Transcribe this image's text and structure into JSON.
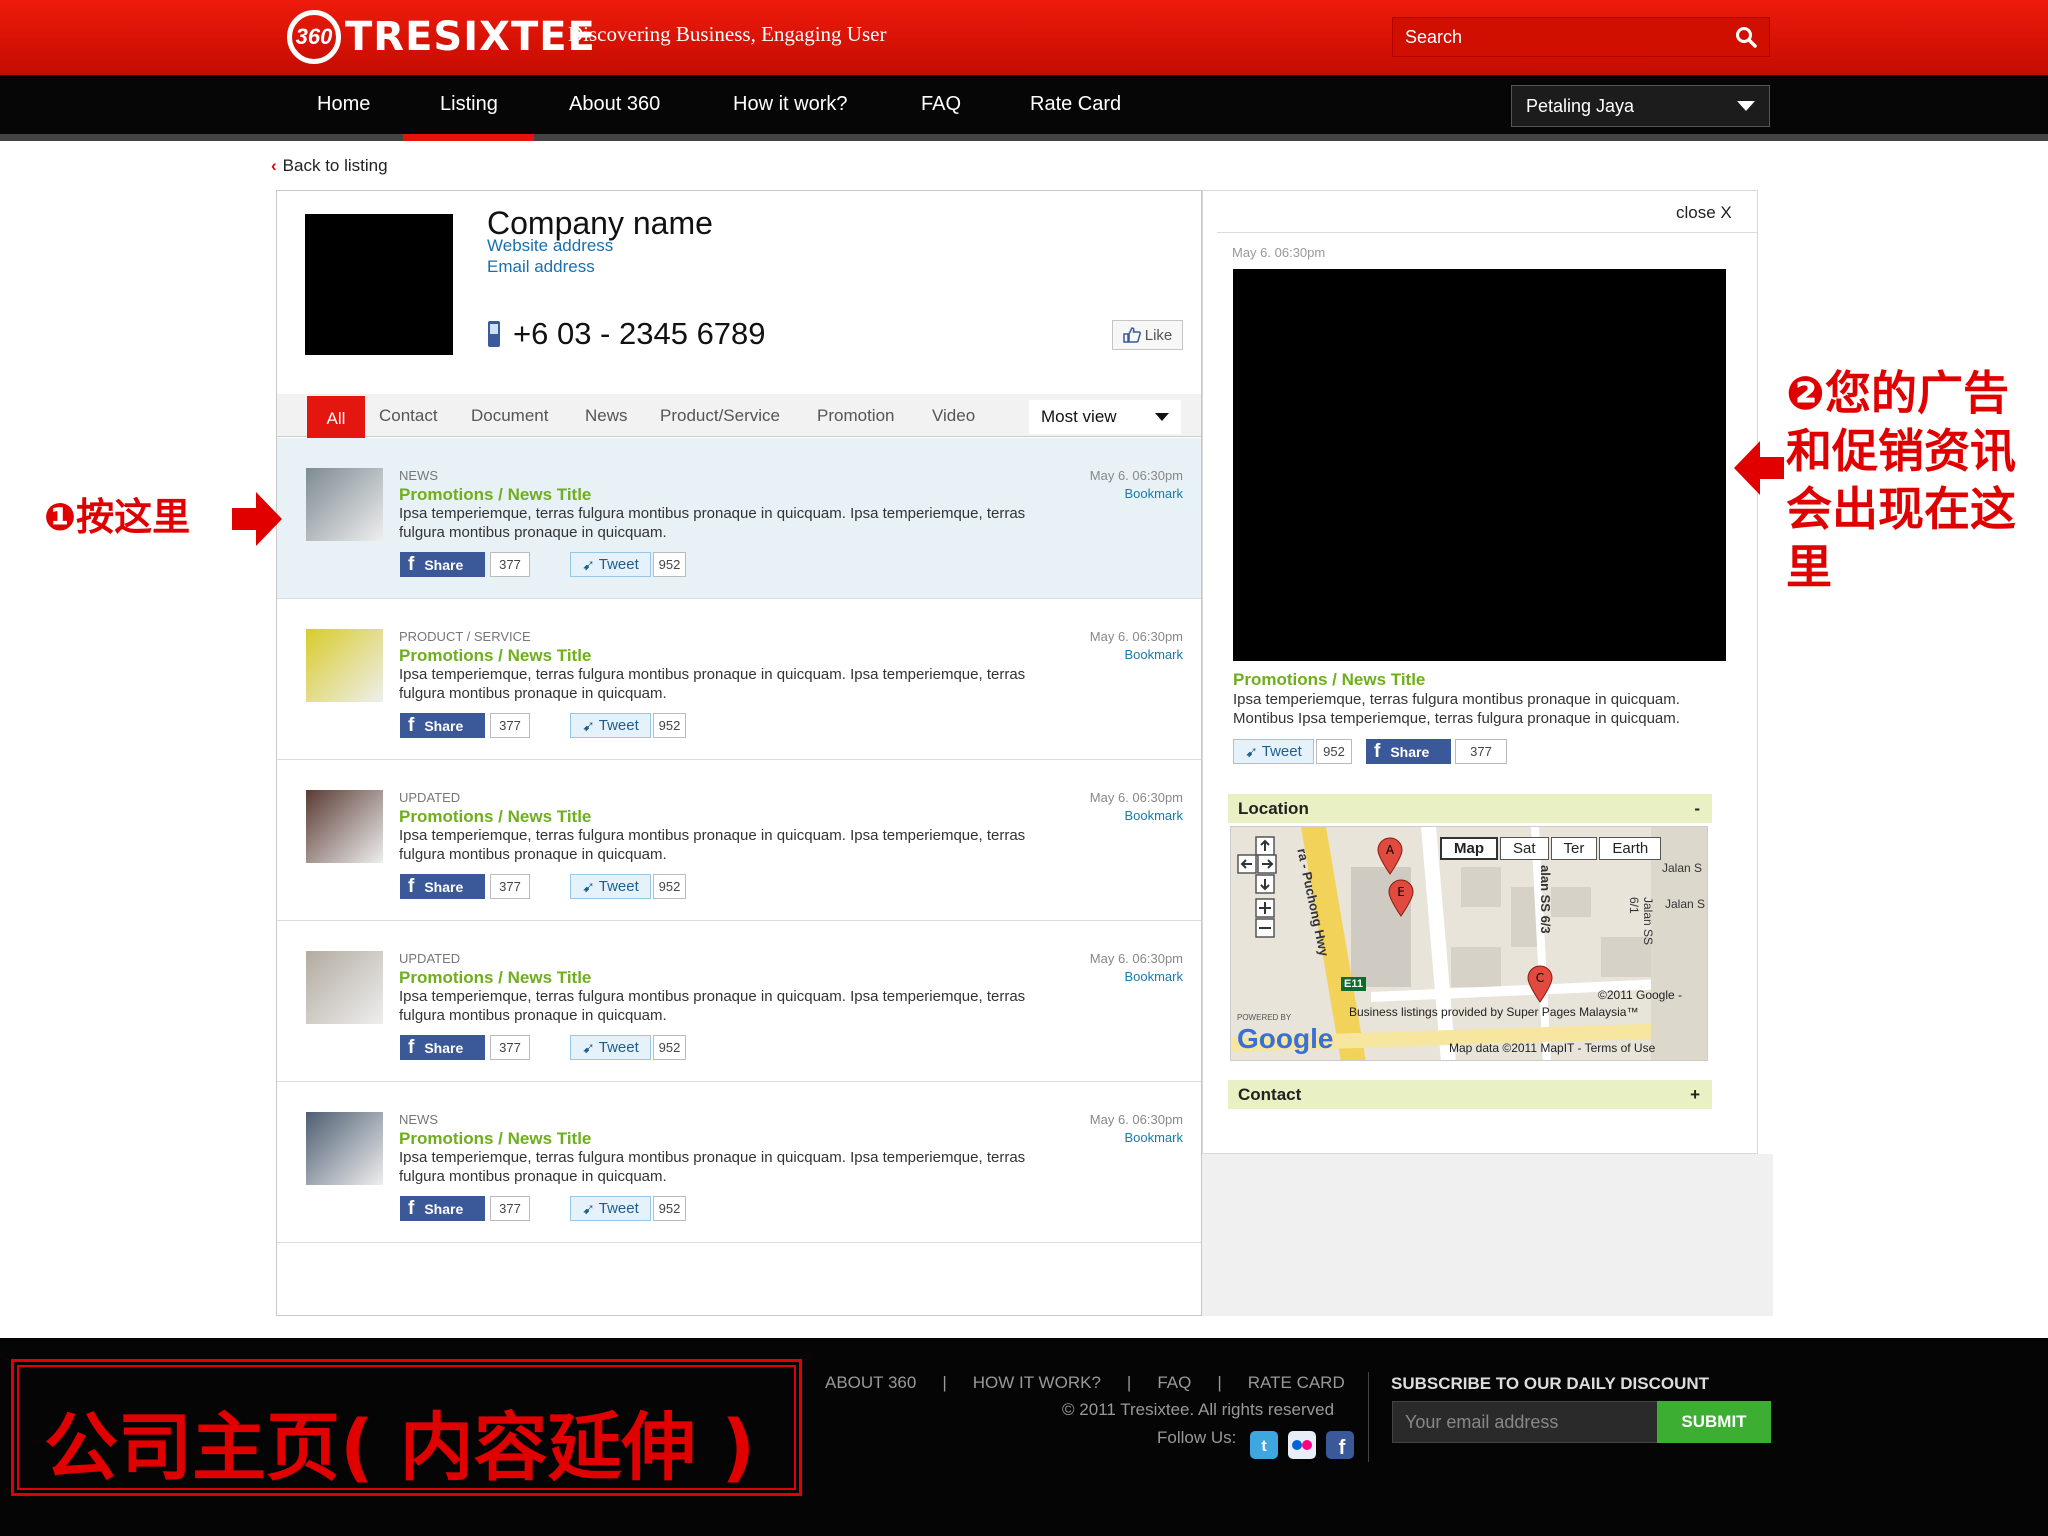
{
  "header": {
    "logo_mark": "360",
    "logo_text": "TRESIXTEE",
    "tagline": "Discovering Business, Engaging User",
    "search_placeholder": "Search"
  },
  "nav": {
    "items": [
      "Home",
      "Listing",
      "About 360",
      "How it work?",
      "FAQ",
      "Rate Card"
    ],
    "active": "Listing",
    "region": "Petaling Jaya"
  },
  "back_link": "Back to listing",
  "company": {
    "name": "Company name",
    "website": "Website address",
    "email": "Email address",
    "phone": "+6 03 - 2345 6789",
    "like_label": "Like"
  },
  "tabs": {
    "all": "All",
    "items": [
      "Contact",
      "Document",
      "News",
      "Product/Service",
      "Promotion",
      "Video"
    ],
    "sort": "Most view"
  },
  "listings": [
    {
      "category": "NEWS",
      "title": "Promotions / News Title",
      "desc": "Ipsa temperiemque, terras fulgura montibus pronaque in quicquam. Ipsa temperiemque, terras fulgura montibus pronaque in quicquam.",
      "date": "May 6. 06:30pm",
      "bookmark": "Bookmark",
      "share": "Share",
      "share_count": "377",
      "tweet": "Tweet",
      "tweet_count": "952",
      "thumb_color": "#7d8a92"
    },
    {
      "category": "PRODUCT / SERVICE",
      "title": "Promotions / News Title",
      "desc": "Ipsa temperiemque, terras fulgura montibus pronaque in quicquam. Ipsa temperiemque, terras fulgura montibus pronaque in quicquam.",
      "date": "May 6. 06:30pm",
      "bookmark": "Bookmark",
      "share": "Share",
      "share_count": "377",
      "tweet": "Tweet",
      "tweet_count": "952",
      "thumb_color": "#d8cc2a"
    },
    {
      "category": "UPDATED",
      "title": "Promotions / News Title",
      "desc": "Ipsa temperiemque, terras fulgura montibus pronaque in quicquam. Ipsa temperiemque, terras fulgura montibus pronaque in quicquam.",
      "date": "May 6. 06:30pm",
      "bookmark": "Bookmark",
      "share": "Share",
      "share_count": "377",
      "tweet": "Tweet",
      "tweet_count": "952",
      "thumb_color": "#5a3b33"
    },
    {
      "category": "UPDATED",
      "title": "Promotions / News Title",
      "desc": "Ipsa temperiemque, terras fulgura montibus pronaque in quicquam. Ipsa temperiemque, terras fulgura montibus pronaque in quicquam.",
      "date": "May 6. 06:30pm",
      "bookmark": "Bookmark",
      "share": "Share",
      "share_count": "377",
      "tweet": "Tweet",
      "tweet_count": "952",
      "thumb_color": "#b2aba0"
    },
    {
      "category": "NEWS",
      "title": "Promotions / News Title",
      "desc": "Ipsa temperiemque, terras fulgura montibus pronaque in quicquam. Ipsa temperiemque, terras fulgura montibus pronaque in quicquam.",
      "date": "May 6. 06:30pm",
      "bookmark": "Bookmark",
      "share": "Share",
      "share_count": "377",
      "tweet": "Tweet",
      "tweet_count": "952",
      "thumb_color": "#4e5e72"
    }
  ],
  "detail": {
    "close": "close X",
    "date": "May 6. 06:30pm",
    "title": "Promotions / News Title",
    "desc": "Ipsa temperiemque, terras fulgura montibus pronaque in quicquam. Montibus Ipsa temperiemque, terras fulgura pronaque in quicquam.",
    "tweet": "Tweet",
    "tweet_count": "952",
    "share": "Share",
    "share_count": "377",
    "location_label": "Location",
    "location_toggle": "-",
    "contact_label": "Contact",
    "contact_toggle": "+"
  },
  "map": {
    "types": [
      "Map",
      "Sat",
      "Ter",
      "Earth"
    ],
    "road_label": "ra - Puchong Hwy",
    "road_ss63": "alan SS 6/3",
    "road_ss61": "Jalan SS 6/1",
    "road_jalan": "Jalan S",
    "road_jalan2": "Jalan S",
    "markers": [
      "A",
      "E",
      "C"
    ],
    "copyright": "©2011 Google -",
    "business": "Business listings provided by Super Pages Malaysia™",
    "mapdata": "Map data ©2011 MapIT - Terms of Use",
    "powered": "POWERED BY",
    "google": "Google",
    "e11": "E11"
  },
  "annotations": {
    "left": "❶按这里",
    "right": "❷您的广告和促销资讯会出现在这里",
    "bottom": "公司主页( 内容延伸 )"
  },
  "footer": {
    "links": [
      "ABOUT 360",
      "HOW IT WORK?",
      "FAQ",
      "RATE CARD"
    ],
    "separator": "|",
    "copyright": "© 2011 Tresixtee. All rights reserved",
    "follow": "Follow Us:",
    "subscribe_heading": "SUBSCRIBE TO OUR DAILY DISCOUNT",
    "email_placeholder": "Your email address",
    "submit": "SUBMIT"
  },
  "colors": {
    "brand_red": "#e31610",
    "accent_green": "#6fae1c",
    "link_blue": "#1a6fae",
    "footer_bg": "#050505"
  }
}
